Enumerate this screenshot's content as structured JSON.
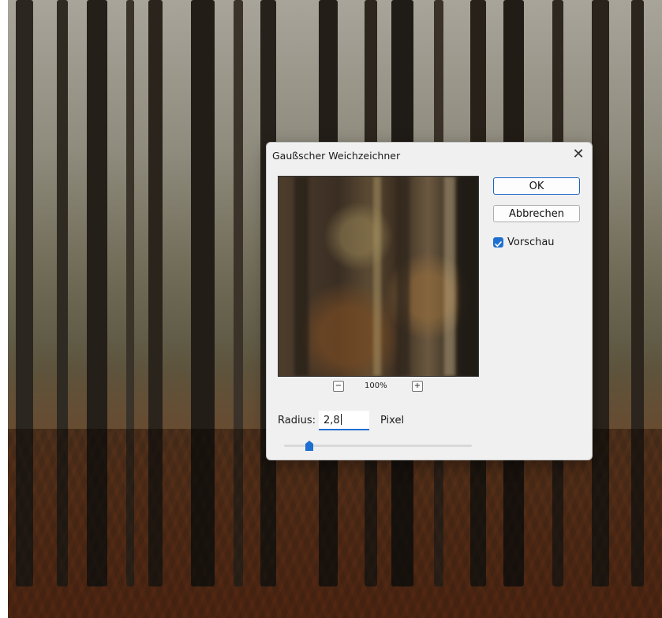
{
  "dialog": {
    "title": "Gaußscher Weichzeichner",
    "ok_label": "OK",
    "cancel_label": "Abbrechen",
    "preview_checkbox_label": "Vorschau",
    "preview_checked": true,
    "zoom_level": "100%",
    "zoom_out_symbol": "−",
    "zoom_in_symbol": "+",
    "radius_label": "Radius:",
    "radius_value": "2,8",
    "radius_unit": "Pixel",
    "accent_color": "#1f6fd0",
    "close_icon": "close-icon"
  }
}
